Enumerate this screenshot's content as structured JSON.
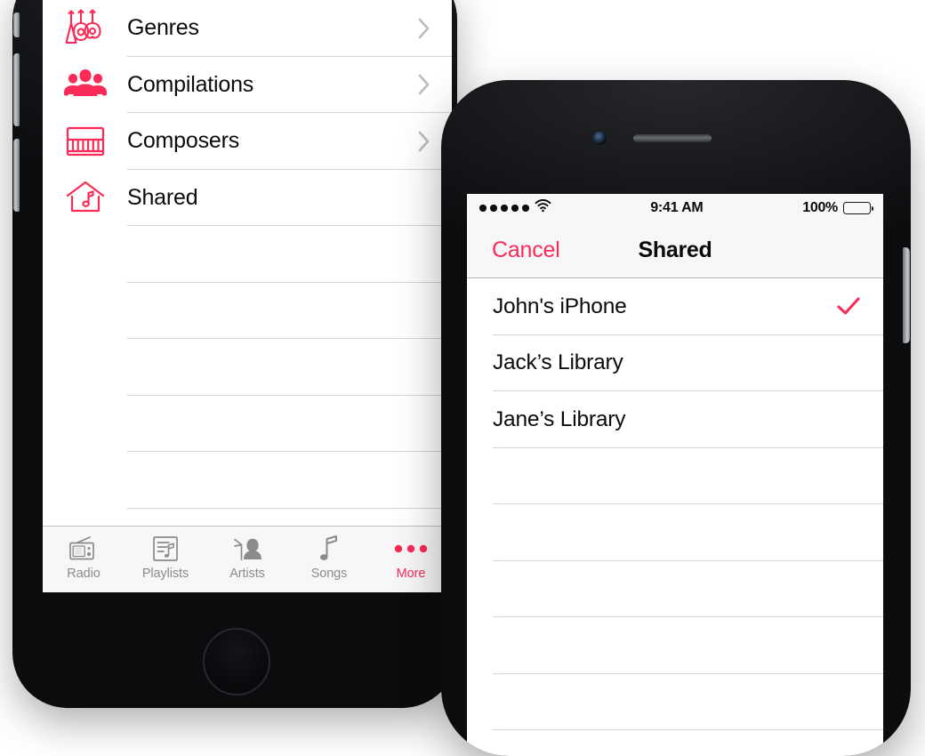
{
  "theme": {
    "accent_pink": "#fa2b56",
    "screen_bg": "#ffffff",
    "bar_bg": "#f7f7f7",
    "separator": "#d3d3d6",
    "text_primary": "#0b0b0c",
    "text_muted": "#8b8b8e",
    "chevron": "#bcbcc0"
  },
  "left_phone": {
    "device_name": "iPhone",
    "app": "Music",
    "list": {
      "rows": [
        {
          "label": "Genres",
          "icon": "guitars-icon",
          "accessory": "chevron-right-icon"
        },
        {
          "label": "Compilations",
          "icon": "people-icon",
          "accessory": "chevron-right-icon"
        },
        {
          "label": "Composers",
          "icon": "piano-icon",
          "accessory": "chevron-right-icon"
        },
        {
          "label": "Shared",
          "icon": "home-music-icon",
          "accessory": ""
        }
      ],
      "empty_row_count": 5
    },
    "tabbar": {
      "tabs": [
        {
          "label": "Radio",
          "icon": "radio-icon",
          "active": false
        },
        {
          "label": "Playlists",
          "icon": "playlist-icon",
          "active": false
        },
        {
          "label": "Artists",
          "icon": "artist-icon",
          "active": false
        },
        {
          "label": "Songs",
          "icon": "music-note-icon",
          "active": false
        },
        {
          "label": "More",
          "icon": "ellipsis-icon",
          "active": true
        }
      ]
    }
  },
  "right_phone": {
    "device_name": "iPhone",
    "status_bar": {
      "signal_dots": 5,
      "wifi": "wifi-icon",
      "time": "9:41 AM",
      "battery_percent": "100%",
      "battery_icon": "battery-full-icon"
    },
    "nav_bar": {
      "left_button": "Cancel",
      "title": "Shared"
    },
    "list": {
      "rows": [
        {
          "label": "John's iPhone",
          "selected": true
        },
        {
          "label": "Jack’s Library",
          "selected": false
        },
        {
          "label": "Jane’s Library",
          "selected": false
        }
      ],
      "empty_row_count": 5,
      "checkmark_icon": "checkmark-icon"
    }
  }
}
